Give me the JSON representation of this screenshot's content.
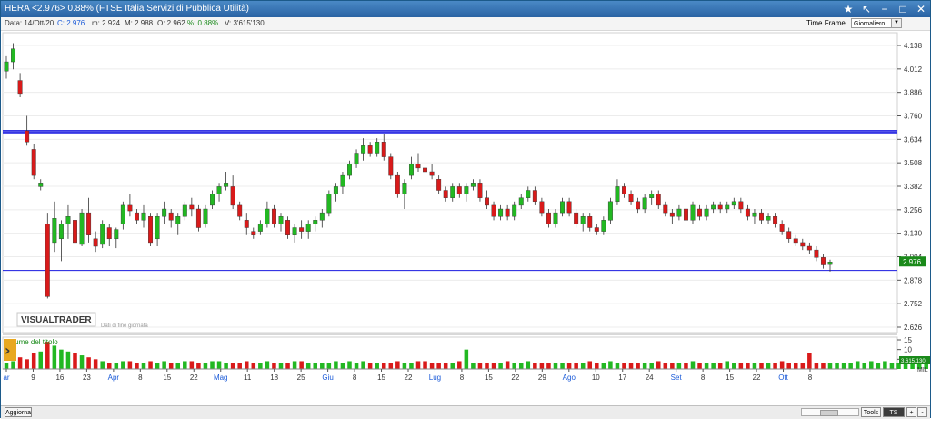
{
  "window": {
    "title": "HERA <2.976> 0.88%  (FTSE Italia Servizi di Pubblica Utilità)"
  },
  "info": {
    "data": "Data: 14/Ott/20",
    "close": "C: 2.976",
    "min": "m: 2.924",
    "max": "M: 2.988",
    "open": "O: 2.962",
    "pct": "%: 0.88%",
    "volume": "V: 3'615'130"
  },
  "timeframe": {
    "label": "Time Frame",
    "value": "Giornaliero"
  },
  "price_panel": {
    "logo": "VISUALTRADER",
    "note": "Dati di fine giornata",
    "last_price_badge": "2.976",
    "y_ticks": [
      "4.138",
      "4.012",
      "3.886",
      "3.760",
      "3.634",
      "3.508",
      "3.382",
      "3.256",
      "3.130",
      "3.004",
      "2.878",
      "2.752",
      "2.626"
    ]
  },
  "volume_panel": {
    "title": "Volume del titolo",
    "y_ticks": [
      "15",
      "10",
      "5"
    ],
    "last_badge": "3.615.130",
    "unit": "MIL"
  },
  "x_axis": {
    "labels": [
      {
        "text": "ar",
        "month": true
      },
      {
        "text": "9",
        "month": false
      },
      {
        "text": "16",
        "month": false
      },
      {
        "text": "23",
        "month": false
      },
      {
        "text": "Apr",
        "month": true
      },
      {
        "text": "8",
        "month": false
      },
      {
        "text": "15",
        "month": false
      },
      {
        "text": "22",
        "month": false
      },
      {
        "text": "Mag",
        "month": true
      },
      {
        "text": "11",
        "month": false
      },
      {
        "text": "18",
        "month": false
      },
      {
        "text": "25",
        "month": false
      },
      {
        "text": "Giu",
        "month": true
      },
      {
        "text": "8",
        "month": false
      },
      {
        "text": "15",
        "month": false
      },
      {
        "text": "22",
        "month": false
      },
      {
        "text": "Lug",
        "month": true
      },
      {
        "text": "8",
        "month": false
      },
      {
        "text": "15",
        "month": false
      },
      {
        "text": "22",
        "month": false
      },
      {
        "text": "29",
        "month": false
      },
      {
        "text": "Ago",
        "month": true
      },
      {
        "text": "10",
        "month": false
      },
      {
        "text": "17",
        "month": false
      },
      {
        "text": "24",
        "month": false
      },
      {
        "text": "Set",
        "month": true
      },
      {
        "text": "8",
        "month": false
      },
      {
        "text": "15",
        "month": false
      },
      {
        "text": "22",
        "month": false
      },
      {
        "text": "Ott",
        "month": true
      },
      {
        "text": "8",
        "month": false
      }
    ]
  },
  "bottom": {
    "refresh": "Aggiorna",
    "tools": "Tools",
    "ts": "TS OFF",
    "plus": "+",
    "minus": "-"
  },
  "colors": {
    "up": "#22b822",
    "down": "#d91a1a",
    "hline_top": "#1a1ae0",
    "hline_low": "#1a1ae0",
    "month_label": "#1a5ad8",
    "badge": "#1a8a1a"
  },
  "chart_data": {
    "type": "candlestick",
    "y_range": [
      2.626,
      4.138
    ],
    "horizontal_lines": [
      3.68,
      3.67,
      2.93
    ],
    "last_close": 2.976,
    "last_close_date": "14/Ott/20",
    "candles": [
      {
        "o": 4.0,
        "h": 4.08,
        "l": 3.96,
        "c": 4.05
      },
      {
        "o": 4.05,
        "h": 4.15,
        "l": 4.01,
        "c": 4.12
      },
      {
        "o": 3.95,
        "h": 3.99,
        "l": 3.86,
        "c": 3.88
      },
      {
        "o": 3.68,
        "h": 3.76,
        "l": 3.6,
        "c": 3.62
      },
      {
        "o": 3.58,
        "h": 3.61,
        "l": 3.42,
        "c": 3.44
      },
      {
        "o": 3.38,
        "h": 3.42,
        "l": 3.36,
        "c": 3.4
      },
      {
        "o": 3.18,
        "h": 3.24,
        "l": 2.78,
        "c": 2.79
      },
      {
        "o": 3.08,
        "h": 3.3,
        "l": 3.03,
        "c": 3.21
      },
      {
        "o": 3.1,
        "h": 3.2,
        "l": 2.98,
        "c": 3.18
      },
      {
        "o": 3.18,
        "h": 3.28,
        "l": 3.1,
        "c": 3.22
      },
      {
        "o": 3.2,
        "h": 3.26,
        "l": 3.06,
        "c": 3.08
      },
      {
        "o": 3.07,
        "h": 3.26,
        "l": 3.06,
        "c": 3.24
      },
      {
        "o": 3.24,
        "h": 3.32,
        "l": 3.08,
        "c": 3.12
      },
      {
        "o": 3.1,
        "h": 3.14,
        "l": 3.03,
        "c": 3.06
      },
      {
        "o": 3.07,
        "h": 3.2,
        "l": 3.05,
        "c": 3.18
      },
      {
        "o": 3.16,
        "h": 3.18,
        "l": 3.06,
        "c": 3.1
      },
      {
        "o": 3.1,
        "h": 3.16,
        "l": 3.05,
        "c": 3.15
      },
      {
        "o": 3.18,
        "h": 3.3,
        "l": 3.15,
        "c": 3.28
      },
      {
        "o": 3.28,
        "h": 3.34,
        "l": 3.22,
        "c": 3.25
      },
      {
        "o": 3.24,
        "h": 3.26,
        "l": 3.18,
        "c": 3.2
      },
      {
        "o": 3.2,
        "h": 3.28,
        "l": 3.16,
        "c": 3.24
      },
      {
        "o": 3.22,
        "h": 3.24,
        "l": 3.06,
        "c": 3.08
      },
      {
        "o": 3.1,
        "h": 3.24,
        "l": 3.06,
        "c": 3.22
      },
      {
        "o": 3.22,
        "h": 3.3,
        "l": 3.18,
        "c": 3.26
      },
      {
        "o": 3.24,
        "h": 3.26,
        "l": 3.16,
        "c": 3.2
      },
      {
        "o": 3.18,
        "h": 3.24,
        "l": 3.12,
        "c": 3.22
      },
      {
        "o": 3.22,
        "h": 3.3,
        "l": 3.2,
        "c": 3.28
      },
      {
        "o": 3.28,
        "h": 3.32,
        "l": 3.22,
        "c": 3.26
      },
      {
        "o": 3.26,
        "h": 3.28,
        "l": 3.14,
        "c": 3.16
      },
      {
        "o": 3.18,
        "h": 3.28,
        "l": 3.16,
        "c": 3.26
      },
      {
        "o": 3.28,
        "h": 3.36,
        "l": 3.26,
        "c": 3.34
      },
      {
        "o": 3.34,
        "h": 3.4,
        "l": 3.3,
        "c": 3.38
      },
      {
        "o": 3.38,
        "h": 3.46,
        "l": 3.36,
        "c": 3.4
      },
      {
        "o": 3.38,
        "h": 3.44,
        "l": 3.26,
        "c": 3.28
      },
      {
        "o": 3.28,
        "h": 3.3,
        "l": 3.2,
        "c": 3.22
      },
      {
        "o": 3.2,
        "h": 3.24,
        "l": 3.12,
        "c": 3.16
      },
      {
        "o": 3.14,
        "h": 3.16,
        "l": 3.1,
        "c": 3.12
      },
      {
        "o": 3.14,
        "h": 3.2,
        "l": 3.12,
        "c": 3.18
      },
      {
        "o": 3.18,
        "h": 3.3,
        "l": 3.16,
        "c": 3.26
      },
      {
        "o": 3.26,
        "h": 3.28,
        "l": 3.16,
        "c": 3.18
      },
      {
        "o": 3.18,
        "h": 3.24,
        "l": 3.14,
        "c": 3.22
      },
      {
        "o": 3.2,
        "h": 3.22,
        "l": 3.1,
        "c": 3.12
      },
      {
        "o": 3.12,
        "h": 3.18,
        "l": 3.08,
        "c": 3.16
      },
      {
        "o": 3.16,
        "h": 3.2,
        "l": 3.1,
        "c": 3.14
      },
      {
        "o": 3.14,
        "h": 3.2,
        "l": 3.1,
        "c": 3.18
      },
      {
        "o": 3.18,
        "h": 3.22,
        "l": 3.14,
        "c": 3.2
      },
      {
        "o": 3.2,
        "h": 3.26,
        "l": 3.16,
        "c": 3.24
      },
      {
        "o": 3.24,
        "h": 3.36,
        "l": 3.22,
        "c": 3.34
      },
      {
        "o": 3.34,
        "h": 3.4,
        "l": 3.3,
        "c": 3.38
      },
      {
        "o": 3.38,
        "h": 3.46,
        "l": 3.34,
        "c": 3.44
      },
      {
        "o": 3.44,
        "h": 3.52,
        "l": 3.42,
        "c": 3.5
      },
      {
        "o": 3.5,
        "h": 3.58,
        "l": 3.48,
        "c": 3.56
      },
      {
        "o": 3.56,
        "h": 3.64,
        "l": 3.52,
        "c": 3.6
      },
      {
        "o": 3.6,
        "h": 3.62,
        "l": 3.54,
        "c": 3.56
      },
      {
        "o": 3.56,
        "h": 3.64,
        "l": 3.54,
        "c": 3.62
      },
      {
        "o": 3.62,
        "h": 3.66,
        "l": 3.52,
        "c": 3.54
      },
      {
        "o": 3.54,
        "h": 3.56,
        "l": 3.42,
        "c": 3.44
      },
      {
        "o": 3.44,
        "h": 3.46,
        "l": 3.32,
        "c": 3.34
      },
      {
        "o": 3.34,
        "h": 3.42,
        "l": 3.26,
        "c": 3.4
      },
      {
        "o": 3.44,
        "h": 3.54,
        "l": 3.42,
        "c": 3.5
      },
      {
        "o": 3.5,
        "h": 3.56,
        "l": 3.46,
        "c": 3.48
      },
      {
        "o": 3.48,
        "h": 3.52,
        "l": 3.44,
        "c": 3.46
      },
      {
        "o": 3.46,
        "h": 3.5,
        "l": 3.42,
        "c": 3.44
      },
      {
        "o": 3.42,
        "h": 3.44,
        "l": 3.34,
        "c": 3.36
      },
      {
        "o": 3.36,
        "h": 3.38,
        "l": 3.3,
        "c": 3.32
      },
      {
        "o": 3.32,
        "h": 3.4,
        "l": 3.3,
        "c": 3.38
      },
      {
        "o": 3.38,
        "h": 3.4,
        "l": 3.32,
        "c": 3.34
      },
      {
        "o": 3.34,
        "h": 3.4,
        "l": 3.3,
        "c": 3.38
      },
      {
        "o": 3.38,
        "h": 3.42,
        "l": 3.36,
        "c": 3.4
      },
      {
        "o": 3.4,
        "h": 3.42,
        "l": 3.3,
        "c": 3.32
      },
      {
        "o": 3.32,
        "h": 3.36,
        "l": 3.26,
        "c": 3.28
      },
      {
        "o": 3.28,
        "h": 3.3,
        "l": 3.2,
        "c": 3.22
      },
      {
        "o": 3.22,
        "h": 3.28,
        "l": 3.2,
        "c": 3.26
      },
      {
        "o": 3.26,
        "h": 3.28,
        "l": 3.2,
        "c": 3.22
      },
      {
        "o": 3.22,
        "h": 3.3,
        "l": 3.2,
        "c": 3.28
      },
      {
        "o": 3.28,
        "h": 3.34,
        "l": 3.26,
        "c": 3.32
      },
      {
        "o": 3.32,
        "h": 3.38,
        "l": 3.3,
        "c": 3.36
      },
      {
        "o": 3.36,
        "h": 3.38,
        "l": 3.28,
        "c": 3.3
      },
      {
        "o": 3.3,
        "h": 3.32,
        "l": 3.22,
        "c": 3.24
      },
      {
        "o": 3.24,
        "h": 3.26,
        "l": 3.16,
        "c": 3.18
      },
      {
        "o": 3.18,
        "h": 3.26,
        "l": 3.16,
        "c": 3.24
      },
      {
        "o": 3.24,
        "h": 3.32,
        "l": 3.22,
        "c": 3.3
      },
      {
        "o": 3.3,
        "h": 3.32,
        "l": 3.22,
        "c": 3.24
      },
      {
        "o": 3.24,
        "h": 3.26,
        "l": 3.16,
        "c": 3.18
      },
      {
        "o": 3.18,
        "h": 3.24,
        "l": 3.14,
        "c": 3.22
      },
      {
        "o": 3.22,
        "h": 3.24,
        "l": 3.14,
        "c": 3.16
      },
      {
        "o": 3.16,
        "h": 3.18,
        "l": 3.12,
        "c": 3.14
      },
      {
        "o": 3.14,
        "h": 3.22,
        "l": 3.12,
        "c": 3.2
      },
      {
        "o": 3.2,
        "h": 3.32,
        "l": 3.18,
        "c": 3.3
      },
      {
        "o": 3.3,
        "h": 3.42,
        "l": 3.28,
        "c": 3.38
      },
      {
        "o": 3.38,
        "h": 3.4,
        "l": 3.32,
        "c": 3.34
      },
      {
        "o": 3.34,
        "h": 3.36,
        "l": 3.28,
        "c": 3.3
      },
      {
        "o": 3.3,
        "h": 3.32,
        "l": 3.24,
        "c": 3.26
      },
      {
        "o": 3.26,
        "h": 3.34,
        "l": 3.24,
        "c": 3.32
      },
      {
        "o": 3.32,
        "h": 3.36,
        "l": 3.28,
        "c": 3.34
      },
      {
        "o": 3.34,
        "h": 3.36,
        "l": 3.26,
        "c": 3.28
      },
      {
        "o": 3.28,
        "h": 3.3,
        "l": 3.22,
        "c": 3.24
      },
      {
        "o": 3.24,
        "h": 3.26,
        "l": 3.18,
        "c": 3.22
      },
      {
        "o": 3.22,
        "h": 3.28,
        "l": 3.2,
        "c": 3.26
      },
      {
        "o": 3.26,
        "h": 3.28,
        "l": 3.18,
        "c": 3.2
      },
      {
        "o": 3.2,
        "h": 3.3,
        "l": 3.18,
        "c": 3.28
      },
      {
        "o": 3.26,
        "h": 3.28,
        "l": 3.2,
        "c": 3.22
      },
      {
        "o": 3.22,
        "h": 3.28,
        "l": 3.2,
        "c": 3.26
      },
      {
        "o": 3.26,
        "h": 3.3,
        "l": 3.24,
        "c": 3.28
      },
      {
        "o": 3.28,
        "h": 3.3,
        "l": 3.24,
        "c": 3.26
      },
      {
        "o": 3.26,
        "h": 3.3,
        "l": 3.24,
        "c": 3.28
      },
      {
        "o": 3.28,
        "h": 3.32,
        "l": 3.26,
        "c": 3.3
      },
      {
        "o": 3.3,
        "h": 3.32,
        "l": 3.24,
        "c": 3.26
      },
      {
        "o": 3.26,
        "h": 3.28,
        "l": 3.2,
        "c": 3.22
      },
      {
        "o": 3.22,
        "h": 3.26,
        "l": 3.18,
        "c": 3.24
      },
      {
        "o": 3.24,
        "h": 3.26,
        "l": 3.18,
        "c": 3.2
      },
      {
        "o": 3.2,
        "h": 3.24,
        "l": 3.18,
        "c": 3.22
      },
      {
        "o": 3.22,
        "h": 3.24,
        "l": 3.16,
        "c": 3.18
      },
      {
        "o": 3.18,
        "h": 3.2,
        "l": 3.12,
        "c": 3.14
      },
      {
        "o": 3.14,
        "h": 3.16,
        "l": 3.08,
        "c": 3.1
      },
      {
        "o": 3.1,
        "h": 3.12,
        "l": 3.06,
        "c": 3.08
      },
      {
        "o": 3.08,
        "h": 3.1,
        "l": 3.04,
        "c": 3.06
      },
      {
        "o": 3.06,
        "h": 3.08,
        "l": 3.02,
        "c": 3.04
      },
      {
        "o": 3.04,
        "h": 3.06,
        "l": 2.98,
        "c": 3.0
      },
      {
        "o": 3.0,
        "h": 3.02,
        "l": 2.94,
        "c": 2.96
      },
      {
        "o": 2.962,
        "h": 2.988,
        "l": 2.924,
        "c": 2.976
      }
    ],
    "volumes": [
      3,
      4,
      6,
      5,
      8,
      9,
      14,
      12,
      10,
      9,
      8,
      7,
      6,
      5,
      4,
      3,
      3,
      4,
      4,
      3,
      3,
      4,
      3,
      4,
      3,
      3,
      4,
      4,
      3,
      3,
      4,
      4,
      3,
      3,
      3,
      4,
      3,
      3,
      4,
      3,
      3,
      3,
      4,
      4,
      3,
      3,
      3,
      3,
      4,
      3,
      4,
      3,
      4,
      3,
      3,
      3,
      3,
      4,
      3,
      3,
      4,
      4,
      3,
      3,
      3,
      3,
      4,
      10,
      3,
      3,
      3,
      3,
      3,
      4,
      3,
      3,
      4,
      3,
      3,
      3,
      3,
      3,
      3,
      3,
      3,
      4,
      3,
      3,
      4,
      3,
      3,
      3,
      3,
      3,
      3,
      4,
      3,
      3,
      3,
      3,
      4,
      3,
      3,
      3,
      3,
      4,
      3,
      3,
      3,
      3,
      3,
      3,
      3,
      4,
      3,
      3,
      3,
      8,
      3,
      3,
      3,
      3,
      3,
      3,
      4,
      3,
      4,
      3,
      4,
      3,
      3,
      3,
      5,
      4,
      3,
      4
    ]
  }
}
